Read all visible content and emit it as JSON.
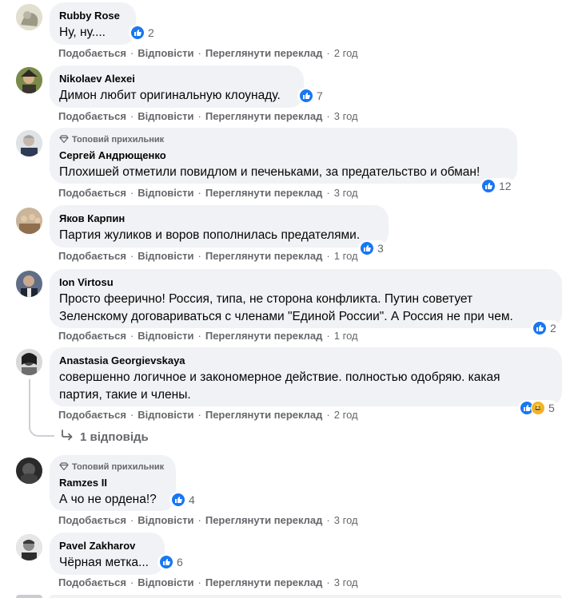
{
  "actions": {
    "like": "Подобається",
    "reply": "Відповісти",
    "translate": "Переглянути переклад"
  },
  "badge_label": "Топовий прихильник",
  "colors": {
    "like_blue": "#1877f2",
    "bubble": "#f0f2f5",
    "muted": "#65676b"
  },
  "comments": [
    {
      "author": "Rubby Rose",
      "text": "Ну, ну....",
      "reactions": "2",
      "time": "2 год"
    },
    {
      "author": "Nikolaev Alexei",
      "text": "Димон любит оригинальную клоунаду.",
      "reactions": "7",
      "time": "3 год"
    },
    {
      "author": "Сергей Андрющенко",
      "text": "Плохишей отметили повидлом и печеньками, за предательство и обман!",
      "reactions": "12",
      "time": "3 год"
    },
    {
      "author": "Яков Карпин",
      "text": "Партия жуликов и воров пополнилась предателями.",
      "reactions": "3",
      "time": "1 год"
    },
    {
      "author": "Ion Virtosu",
      "text_line1": "Просто феерично! Россия, типа, не сторона конфликта. Путин советует",
      "text_line2": "Зеленскому договариваться с членами \"Единой России\". А Россия не при чем.",
      "reactions": "2",
      "time": "1 год"
    },
    {
      "author": "Anastasia Georgievskaya",
      "text_line1": "совершенно логичное и закономерное действие. полностью одобряю. какая",
      "text_line2": "партия, такие и члены.",
      "reactions": "5",
      "time": "2 год",
      "replies": "1 відповідь"
    },
    {
      "author": "Ramzes II",
      "text": "А чо не ордена!?",
      "reactions": "4",
      "time": "3 год"
    },
    {
      "author": "Pavel Zakharov",
      "text": "Чёрная метка...",
      "reactions": "6",
      "time": "3 год"
    }
  ]
}
